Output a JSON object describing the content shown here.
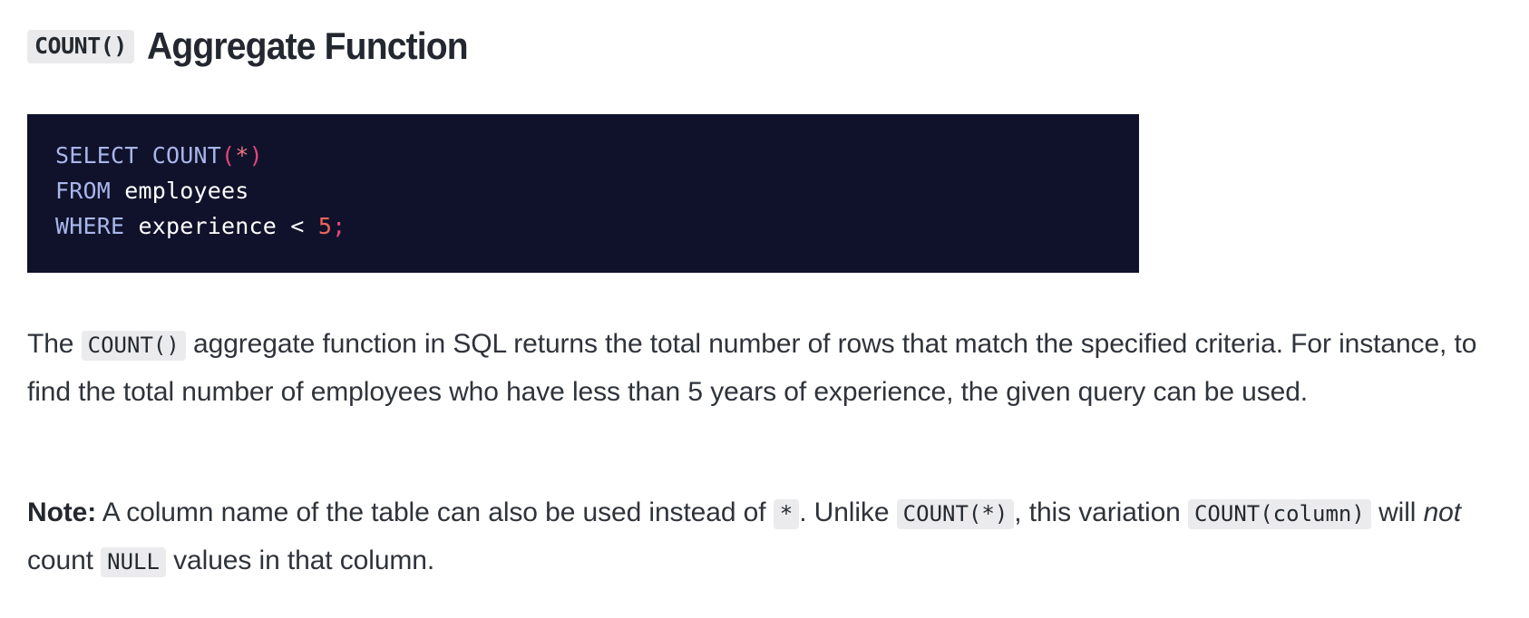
{
  "heading": {
    "code_chip": "COUNT()",
    "title": "Aggregate Function"
  },
  "code_block": {
    "language": "sql",
    "background_color": "#10122b",
    "lines": [
      {
        "tokens": [
          {
            "text": "SELECT",
            "type": "keyword"
          },
          {
            "text": " ",
            "type": "plain"
          },
          {
            "text": "COUNT",
            "type": "keyword"
          },
          {
            "text": "(",
            "type": "punct"
          },
          {
            "text": "*",
            "type": "star"
          },
          {
            "text": ")",
            "type": "punct"
          }
        ]
      },
      {
        "tokens": [
          {
            "text": "FROM",
            "type": "keyword"
          },
          {
            "text": " employees",
            "type": "plain"
          }
        ]
      },
      {
        "tokens": [
          {
            "text": "WHERE",
            "type": "keyword"
          },
          {
            "text": " experience ",
            "type": "plain"
          },
          {
            "text": "<",
            "type": "operator"
          },
          {
            "text": " ",
            "type": "plain"
          },
          {
            "text": "5",
            "type": "number"
          },
          {
            "text": ";",
            "type": "punct"
          }
        ]
      }
    ],
    "colors": {
      "keyword": "#a9b6ea",
      "punct": "#e2467c",
      "star": "#f0757f",
      "number": "#f2635c",
      "plain": "#ffffff"
    }
  },
  "paragraph_1": {
    "part_1": "The ",
    "code_1": "COUNT()",
    "part_2": " aggregate function in SQL returns the total number of rows that match the specified criteria. For instance, to find the total number of employees who have less than 5 years of experience, the given query can be used."
  },
  "paragraph_2": {
    "label": "Note:",
    "part_1": " A column name of the table can also be used instead of ",
    "code_1": "*",
    "part_2": ". Unlike ",
    "code_2": "COUNT(*)",
    "part_3": ", this variation ",
    "code_3": "COUNT(column)",
    "part_4": " will ",
    "emphasis": "not",
    "part_5": " count ",
    "code_4": "NULL",
    "part_6": " values in that column."
  }
}
